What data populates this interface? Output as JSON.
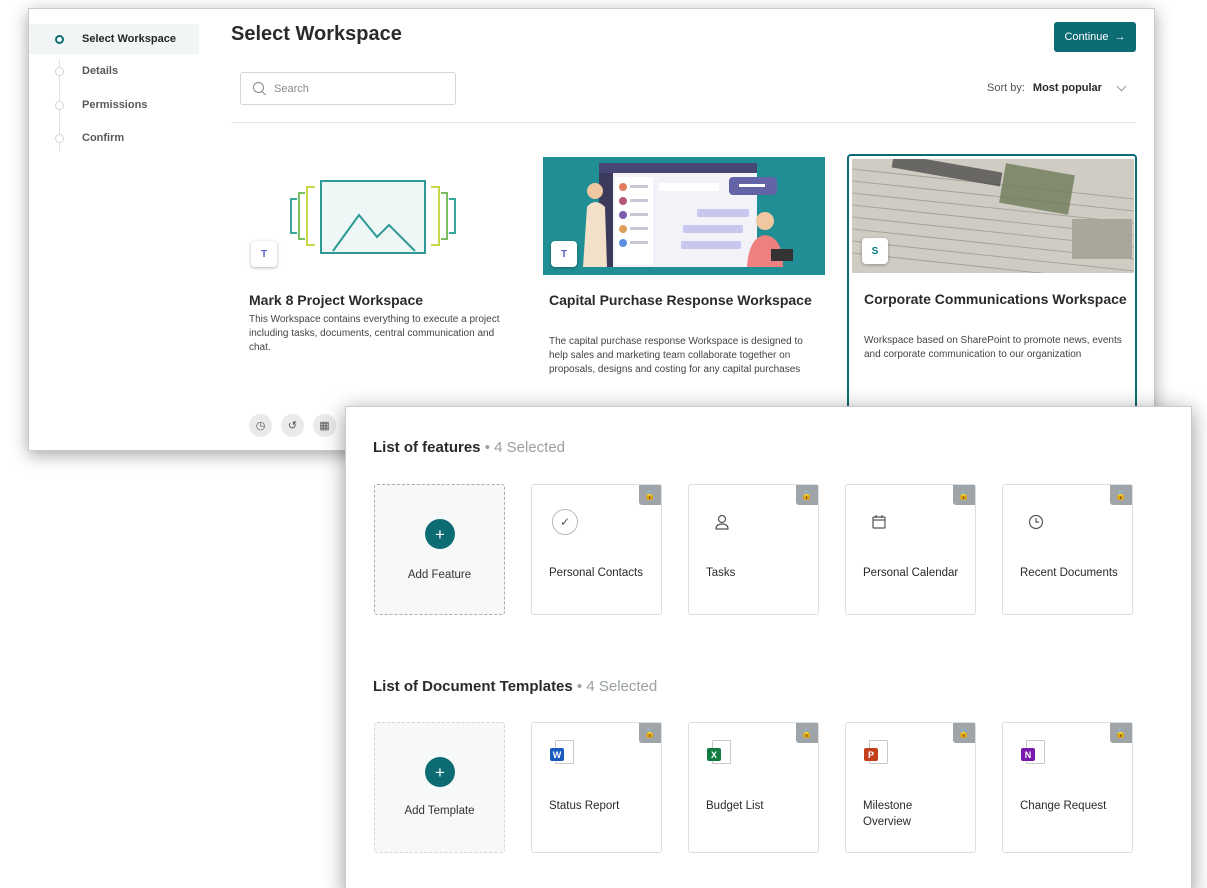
{
  "wizard": {
    "steps": [
      {
        "label": "Select Workspace"
      },
      {
        "label": "Details"
      },
      {
        "label": "Permissions"
      },
      {
        "label": "Confirm"
      }
    ],
    "title": "Select Workspace",
    "continue_label": "Continue",
    "search_placeholder": "Search",
    "sort_label": "Sort by:",
    "sort_value": "Most popular"
  },
  "workspaces": [
    {
      "title": "Mark 8 Project Workspace",
      "description": "This Workspace contains everything to execute a project including tasks, documents, central communication and chat.",
      "app_icon": "teams-icon",
      "selected": false
    },
    {
      "title": "Capital Purchase Response Workspace",
      "description": "The capital purchase response Workspace is designed to help sales and marketing team collaborate together on proposals, designs and costing for any capital purchases",
      "app_icon": "teams-icon",
      "selected": false
    },
    {
      "title": "Corporate Communications Workspace",
      "description": "Workspace based on SharePoint to promote news, events and corporate communication to our organization",
      "app_icon": "sharepoint-icon",
      "selected": true
    }
  ],
  "features": {
    "title": "List of features",
    "count": "• 4 Selected",
    "add_label": "Add Feature",
    "items": [
      {
        "label": "Personal Contacts",
        "icon": "check-circle-icon"
      },
      {
        "label": "Tasks",
        "icon": "person-icon"
      },
      {
        "label": "Personal Calendar",
        "icon": "calendar-icon"
      },
      {
        "label": "Recent Documents",
        "icon": "clock-icon"
      }
    ]
  },
  "templates": {
    "title": "List of Document Templates",
    "count": "• 4 Selected",
    "add_label": "Add Template",
    "items": [
      {
        "label": "Status Report",
        "icon": "word-icon",
        "letter": "W",
        "color": "#185abd"
      },
      {
        "label": "Budget List",
        "icon": "excel-icon",
        "letter": "X",
        "color": "#107c41"
      },
      {
        "label": "Milestone Overview",
        "icon": "powerpoint-icon",
        "letter": "P",
        "color": "#c43e1c"
      },
      {
        "label": "Change Request",
        "icon": "onenote-icon",
        "letter": "N",
        "color": "#7719aa"
      }
    ]
  },
  "colors": {
    "accent": "#0d6c73"
  }
}
